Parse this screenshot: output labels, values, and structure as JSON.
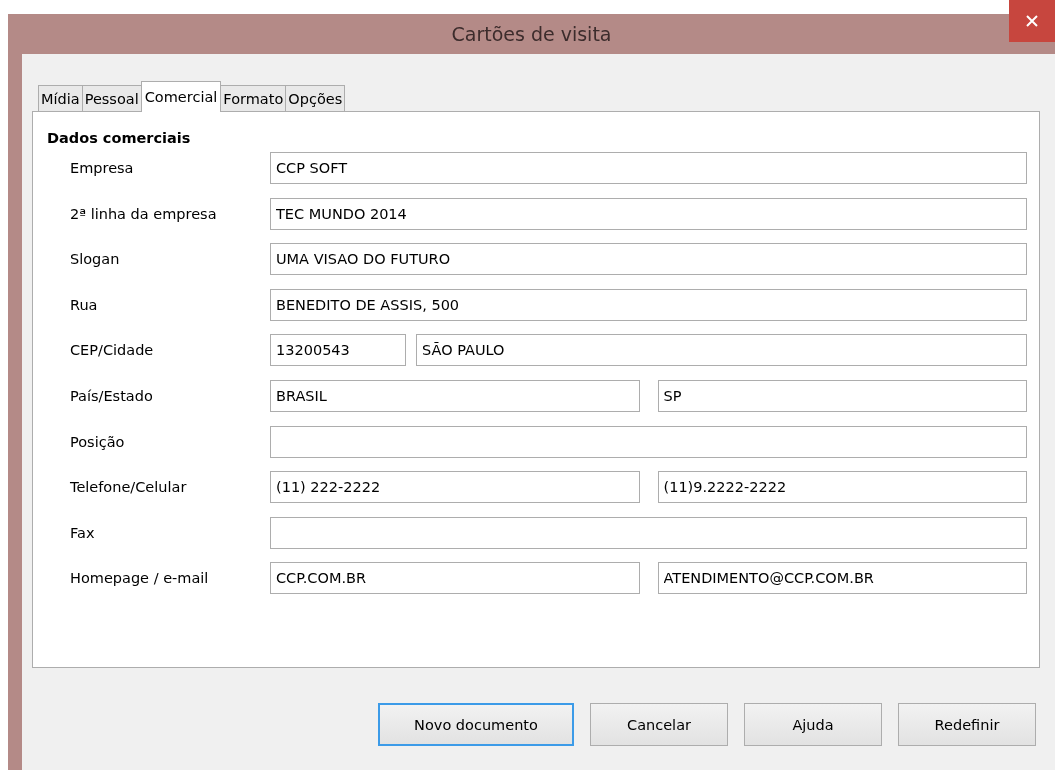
{
  "window": {
    "title": "Cartões de visita"
  },
  "tabs": [
    {
      "label": "Mídia",
      "selected": false
    },
    {
      "label": "Pessoal",
      "selected": false
    },
    {
      "label": "Comercial",
      "selected": true
    },
    {
      "label": "Formato",
      "selected": false
    },
    {
      "label": "Opções",
      "selected": false
    }
  ],
  "section": {
    "heading": "Dados comerciais"
  },
  "rows": [
    {
      "label": "Empresa",
      "kind": "single",
      "values": [
        "CCP SOFT"
      ]
    },
    {
      "label": "2ª linha da empresa",
      "kind": "single",
      "values": [
        "TEC MUNDO 2014"
      ]
    },
    {
      "label": "Slogan",
      "kind": "single",
      "values": [
        "UMA VISAO DO FUTURO"
      ]
    },
    {
      "label": "Rua",
      "kind": "single",
      "values": [
        "BENEDITO DE ASSIS, 500"
      ]
    },
    {
      "label": "CEP/Cidade",
      "kind": "short-long",
      "values": [
        "13200543",
        "SÃO PAULO"
      ]
    },
    {
      "label": "País/Estado",
      "kind": "pair",
      "values": [
        "BRASIL",
        "SP"
      ]
    },
    {
      "label": "Posição",
      "kind": "single"
    },
    {
      "label": "Telefone/Celular",
      "kind": "pair",
      "values": [
        "(11) 222-2222",
        "(11)9.2222-2222"
      ]
    },
    {
      "label": "Fax",
      "kind": "single"
    },
    {
      "label": "Homepage / e-mail",
      "kind": "pair",
      "values": [
        "CCP.COM.BR",
        "ATENDIMENTO@CCP.COM.BR"
      ]
    }
  ],
  "buttons": [
    {
      "label": "Novo documento",
      "default": true
    },
    {
      "label": "Cancelar",
      "default": false
    },
    {
      "label": "Ajuda",
      "default": false
    },
    {
      "label": "Redefinir",
      "default": false
    }
  ]
}
